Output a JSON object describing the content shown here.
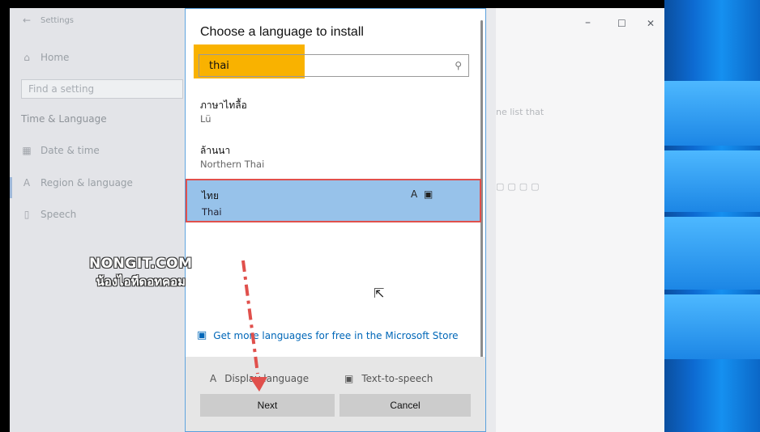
{
  "settings": {
    "back_icon": "back-arrow-icon",
    "title": "Settings",
    "home": "Home",
    "find_placeholder": "Find a setting",
    "section": "Time & Language",
    "nav": [
      {
        "label": "Date & time",
        "icon": "calendar-icon"
      },
      {
        "label": "Region & language",
        "icon": "language-icon"
      },
      {
        "label": "Speech",
        "icon": "microphone-icon"
      }
    ],
    "right_text": "ne list that",
    "window_controls": {
      "minimize": "–",
      "maximize": "☐",
      "close": "✕"
    }
  },
  "dialog": {
    "title": "Choose a language to install",
    "search_value": "thai",
    "languages": [
      {
        "native": "ภาษาไทลื้อ",
        "english": "Lü"
      },
      {
        "native": "ล้านนา",
        "english": "Northern Thai"
      },
      {
        "native": "ไทย",
        "english": "Thai",
        "selected": true
      }
    ],
    "store_link": "Get more languages for free in the Microsoft Store",
    "footer": {
      "display_language": "Display language",
      "text_to_speech": "Text-to-speech",
      "next": "Next",
      "cancel": "Cancel"
    }
  },
  "watermark": {
    "line1": "NONGIT.COM",
    "line2": "น้องไอทีดอทคอม"
  },
  "colors": {
    "selected_bg": "#97c2ea",
    "highlight": "#f9b200",
    "annotation_red": "#e0504c",
    "link": "#0067b8"
  }
}
